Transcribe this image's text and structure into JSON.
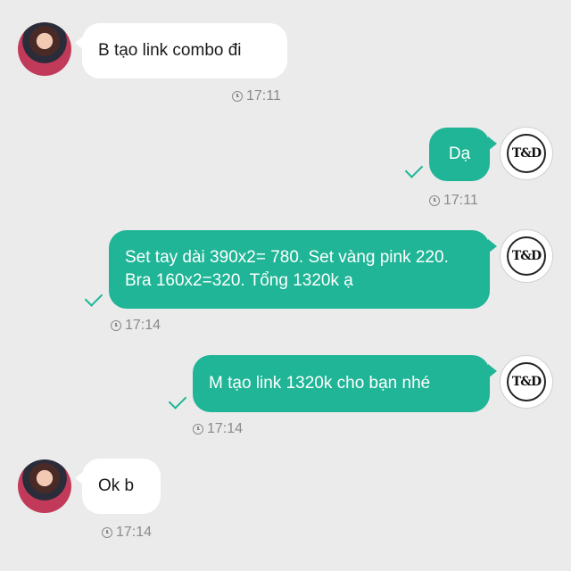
{
  "conversation": {
    "messages": [
      {
        "sender": "customer",
        "text": "B tạo link combo đi",
        "time": "17:11"
      },
      {
        "sender": "shop",
        "text": "Dạ",
        "time": "17:11",
        "status": "sent"
      },
      {
        "sender": "shop",
        "text": "Set tay dài 390x2= 780. Set vàng pink 220. Bra 160x2=320. Tổng 1320k ạ",
        "time": "17:14",
        "status": "sent"
      },
      {
        "sender": "shop",
        "text": "M tạo link 1320k cho bạn nhé",
        "time": "17:14",
        "status": "sent"
      },
      {
        "sender": "customer",
        "text": "Ok b",
        "time": "17:14"
      }
    ]
  },
  "shop_avatar": {
    "logo_text": "T&D",
    "icon": "shop-logo-icon"
  },
  "customer_avatar": {
    "icon": "customer-avatar-photo"
  },
  "colors": {
    "background": "#ebebeb",
    "outgoing_bubble": "#1fb596",
    "incoming_bubble": "#ffffff",
    "timestamp": "#8a8a8a"
  }
}
